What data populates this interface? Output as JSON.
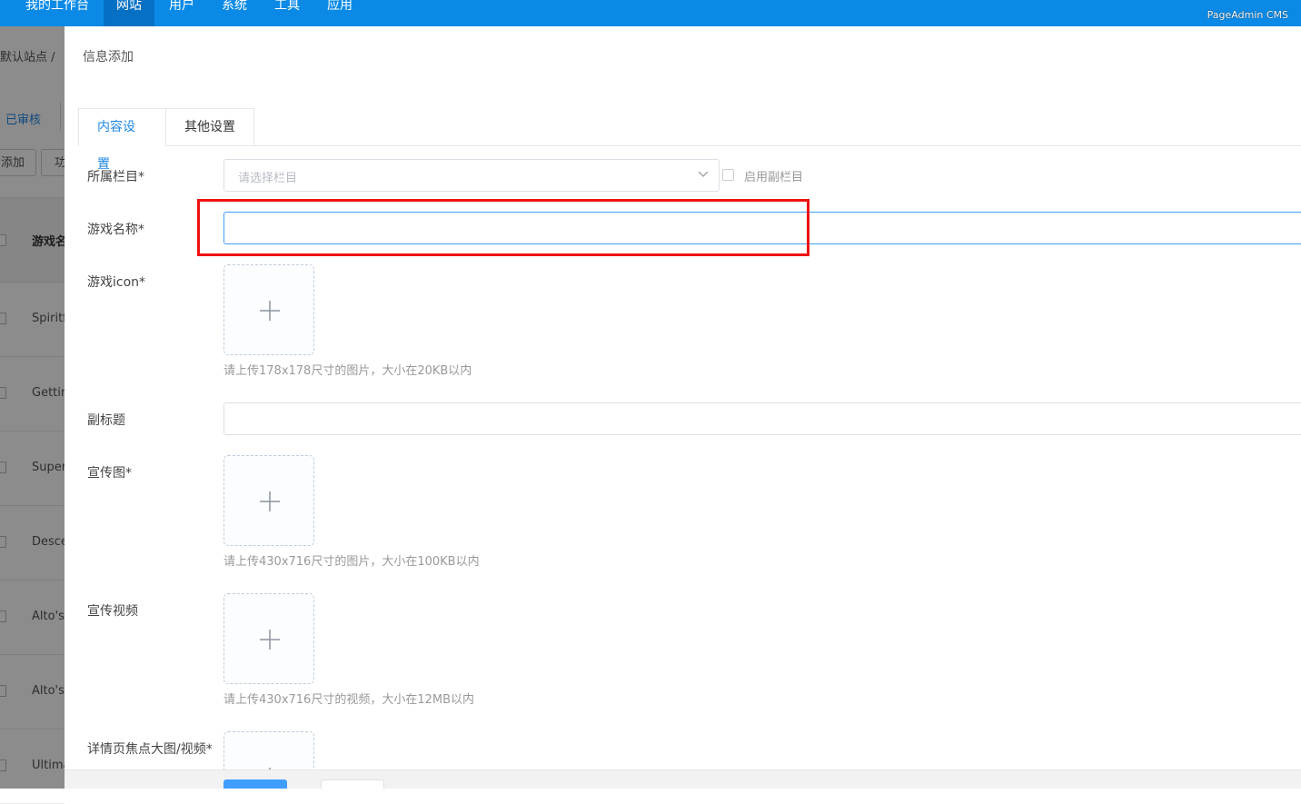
{
  "topnav": {
    "items": [
      "我的工作台",
      "网站",
      "用户",
      "系统",
      "工具",
      "应用"
    ],
    "active_index": 1,
    "brand": "PageAdmin CMS"
  },
  "background": {
    "breadcrumb": "默认站点 /",
    "tab": "已审核",
    "buttons": [
      "添加",
      "功"
    ],
    "table_header": "游戏名",
    "rows": [
      "Spiritf",
      "Gettin",
      "Super",
      "Desce",
      "Alto's",
      "Alto's",
      "Ultima"
    ]
  },
  "drawer": {
    "title": "信息添加",
    "tabs": [
      "内容设置",
      "其他设置"
    ],
    "active_tab": 0,
    "fields": {
      "category": {
        "label": "所属栏目*",
        "placeholder": "请选择栏目",
        "sub_check_label": "启用副栏目"
      },
      "game_name": {
        "label": "游戏名称*",
        "value": ""
      },
      "game_icon": {
        "label": "游戏icon*",
        "hint": "请上传178x178尺寸的图片，大小在20KB以内"
      },
      "subtitle": {
        "label": "副标题",
        "value": ""
      },
      "promo_image": {
        "label": "宣传图*",
        "hint": "请上传430x716尺寸的图片，大小在100KB以内"
      },
      "promo_video": {
        "label": "宣传视频",
        "hint": "请上传430x716尺寸的视频，大小在12MB以内"
      },
      "detail_focus": {
        "label": "详情页焦点大图/视频*"
      }
    }
  },
  "colors": {
    "nav_bg": "#0a8ae6",
    "accent": "#1e88e5",
    "highlight": "#ee1111"
  }
}
